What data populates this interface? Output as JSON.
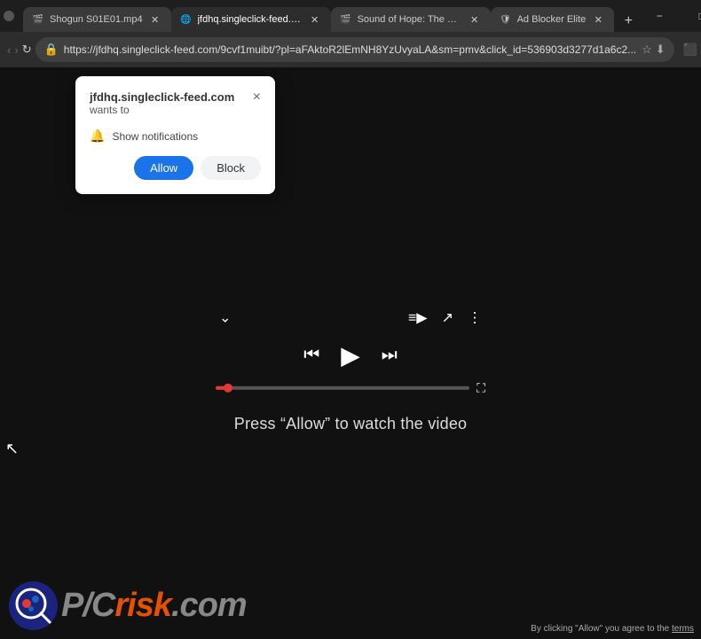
{
  "browser": {
    "tabs": [
      {
        "id": "tab1",
        "title": "Shogun S01E01.mp4",
        "active": false,
        "favicon": "🎬"
      },
      {
        "id": "tab2",
        "title": "jfdhq.singleclick-feed.com",
        "active": true,
        "favicon": "🌐"
      },
      {
        "id": "tab3",
        "title": "Sound of Hope: The Story...",
        "active": false,
        "favicon": "🎬"
      },
      {
        "id": "tab4",
        "title": "Ad Blocker Elite",
        "active": false,
        "favicon": "🛡"
      }
    ],
    "url": "https://jfdhq.singleclick-feed.com/9cvf1muibt/?pl=aFAktoR2lEmNH8YzUvyaLA&sm=pmv&click_id=536903d3277d1a6c2...",
    "window_controls": {
      "minimize": "−",
      "maximize": "□",
      "close": "✕"
    }
  },
  "notification_popup": {
    "domain": "jfdhq.singleclick-feed.com",
    "wants_to": "wants to",
    "notification_label": "Show notifications",
    "allow_label": "Allow",
    "block_label": "Block",
    "close_label": "×"
  },
  "video_player": {
    "press_allow_text": "Press “Allow” to watch the video"
  },
  "pcrisk": {
    "icon_symbol": "🔍",
    "text_pc": "PC",
    "text_slash": "/",
    "text_risk": "risk",
    "text_dotcom": ".com"
  },
  "disclaimer": {
    "text": "By clicking \"Allow\" you agree to the ",
    "link_text": "terms"
  },
  "nav": {
    "back": "‹",
    "forward": "›",
    "reload": "↻"
  }
}
